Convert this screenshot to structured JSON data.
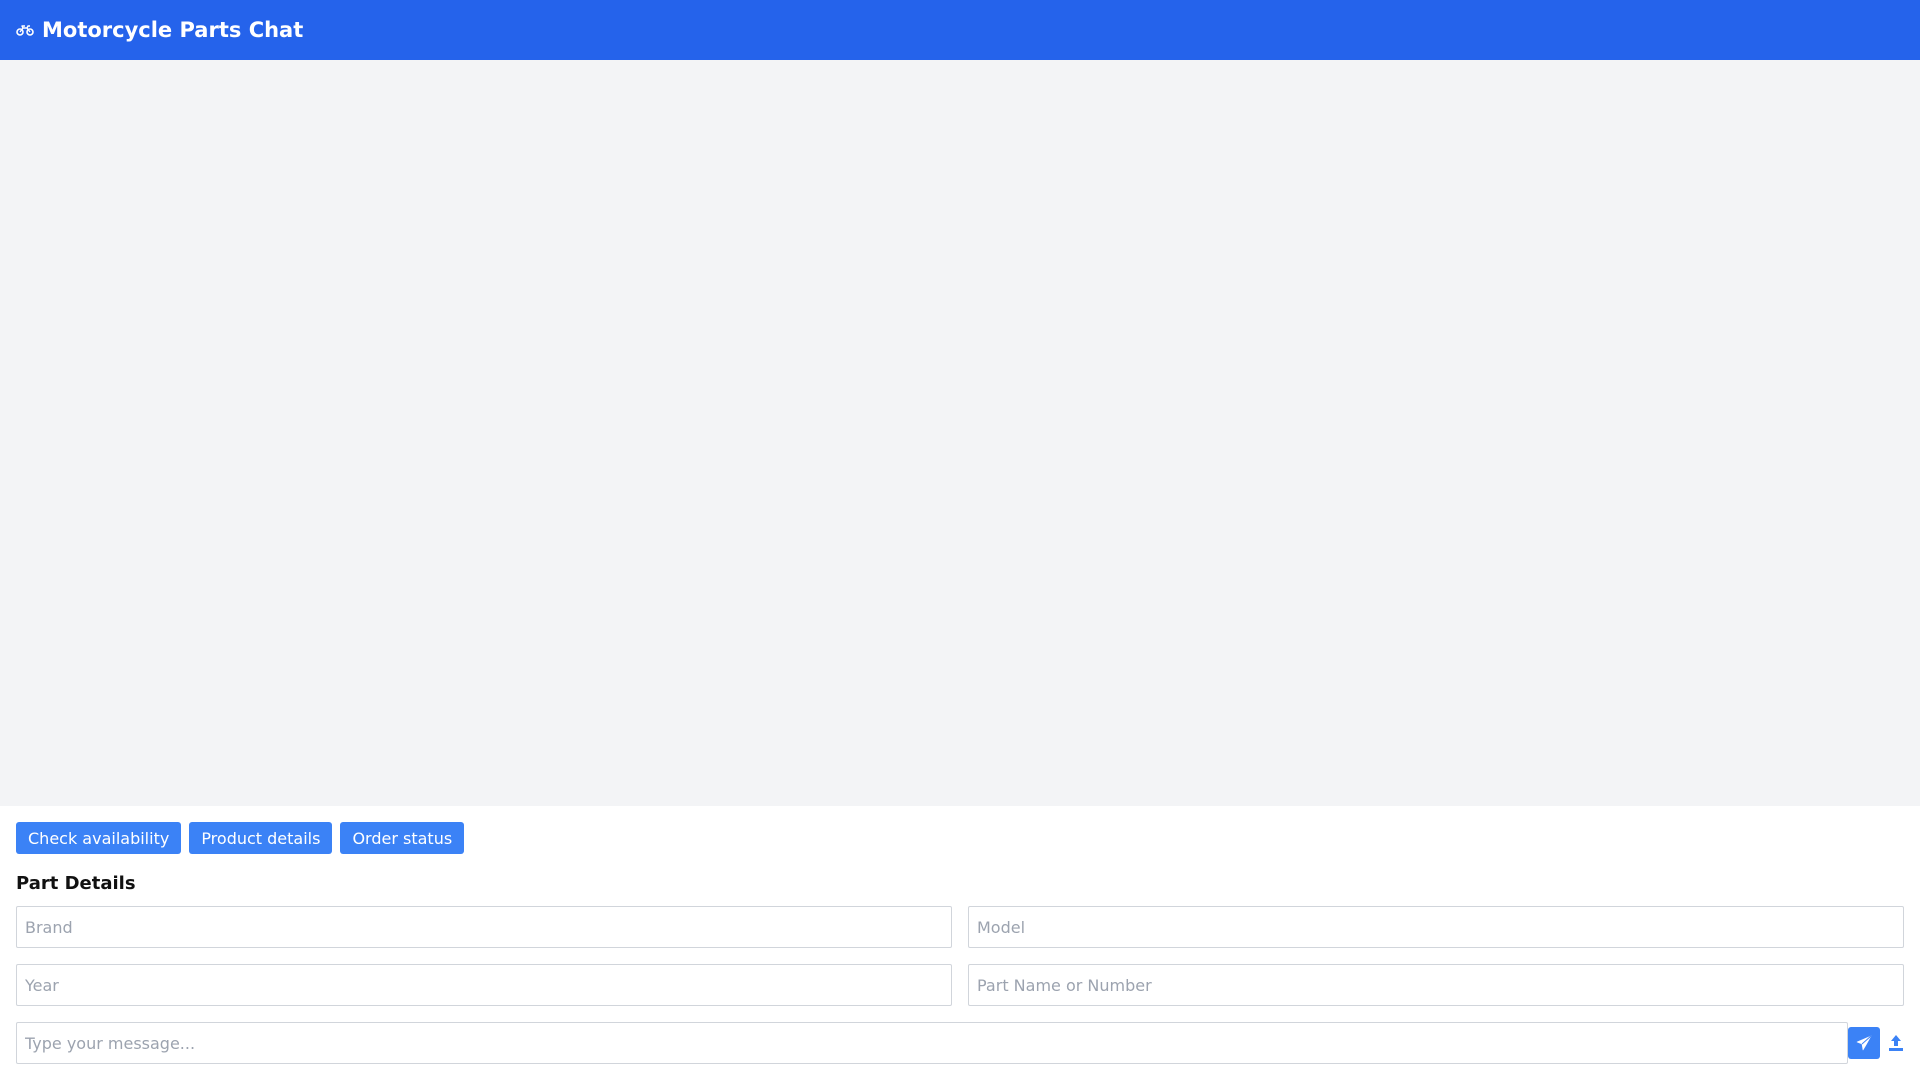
{
  "app": {
    "title": "Motorcycle Parts Chat",
    "logo_icon": "motorcycle-icon"
  },
  "colors": {
    "header_bg": "#2563eb",
    "accent": "#3b82f6",
    "chat_bg": "#f3f4f6"
  },
  "quick_actions": [
    {
      "label": "Check availability"
    },
    {
      "label": "Product details"
    },
    {
      "label": "Order status"
    }
  ],
  "part_details": {
    "heading": "Part Details",
    "brand_placeholder": "Brand",
    "model_placeholder": "Model",
    "year_placeholder": "Year",
    "part_placeholder": "Part Name or Number"
  },
  "composer": {
    "placeholder": "Type your message...",
    "send_icon": "paper-plane-icon",
    "upload_icon": "upload-icon"
  }
}
